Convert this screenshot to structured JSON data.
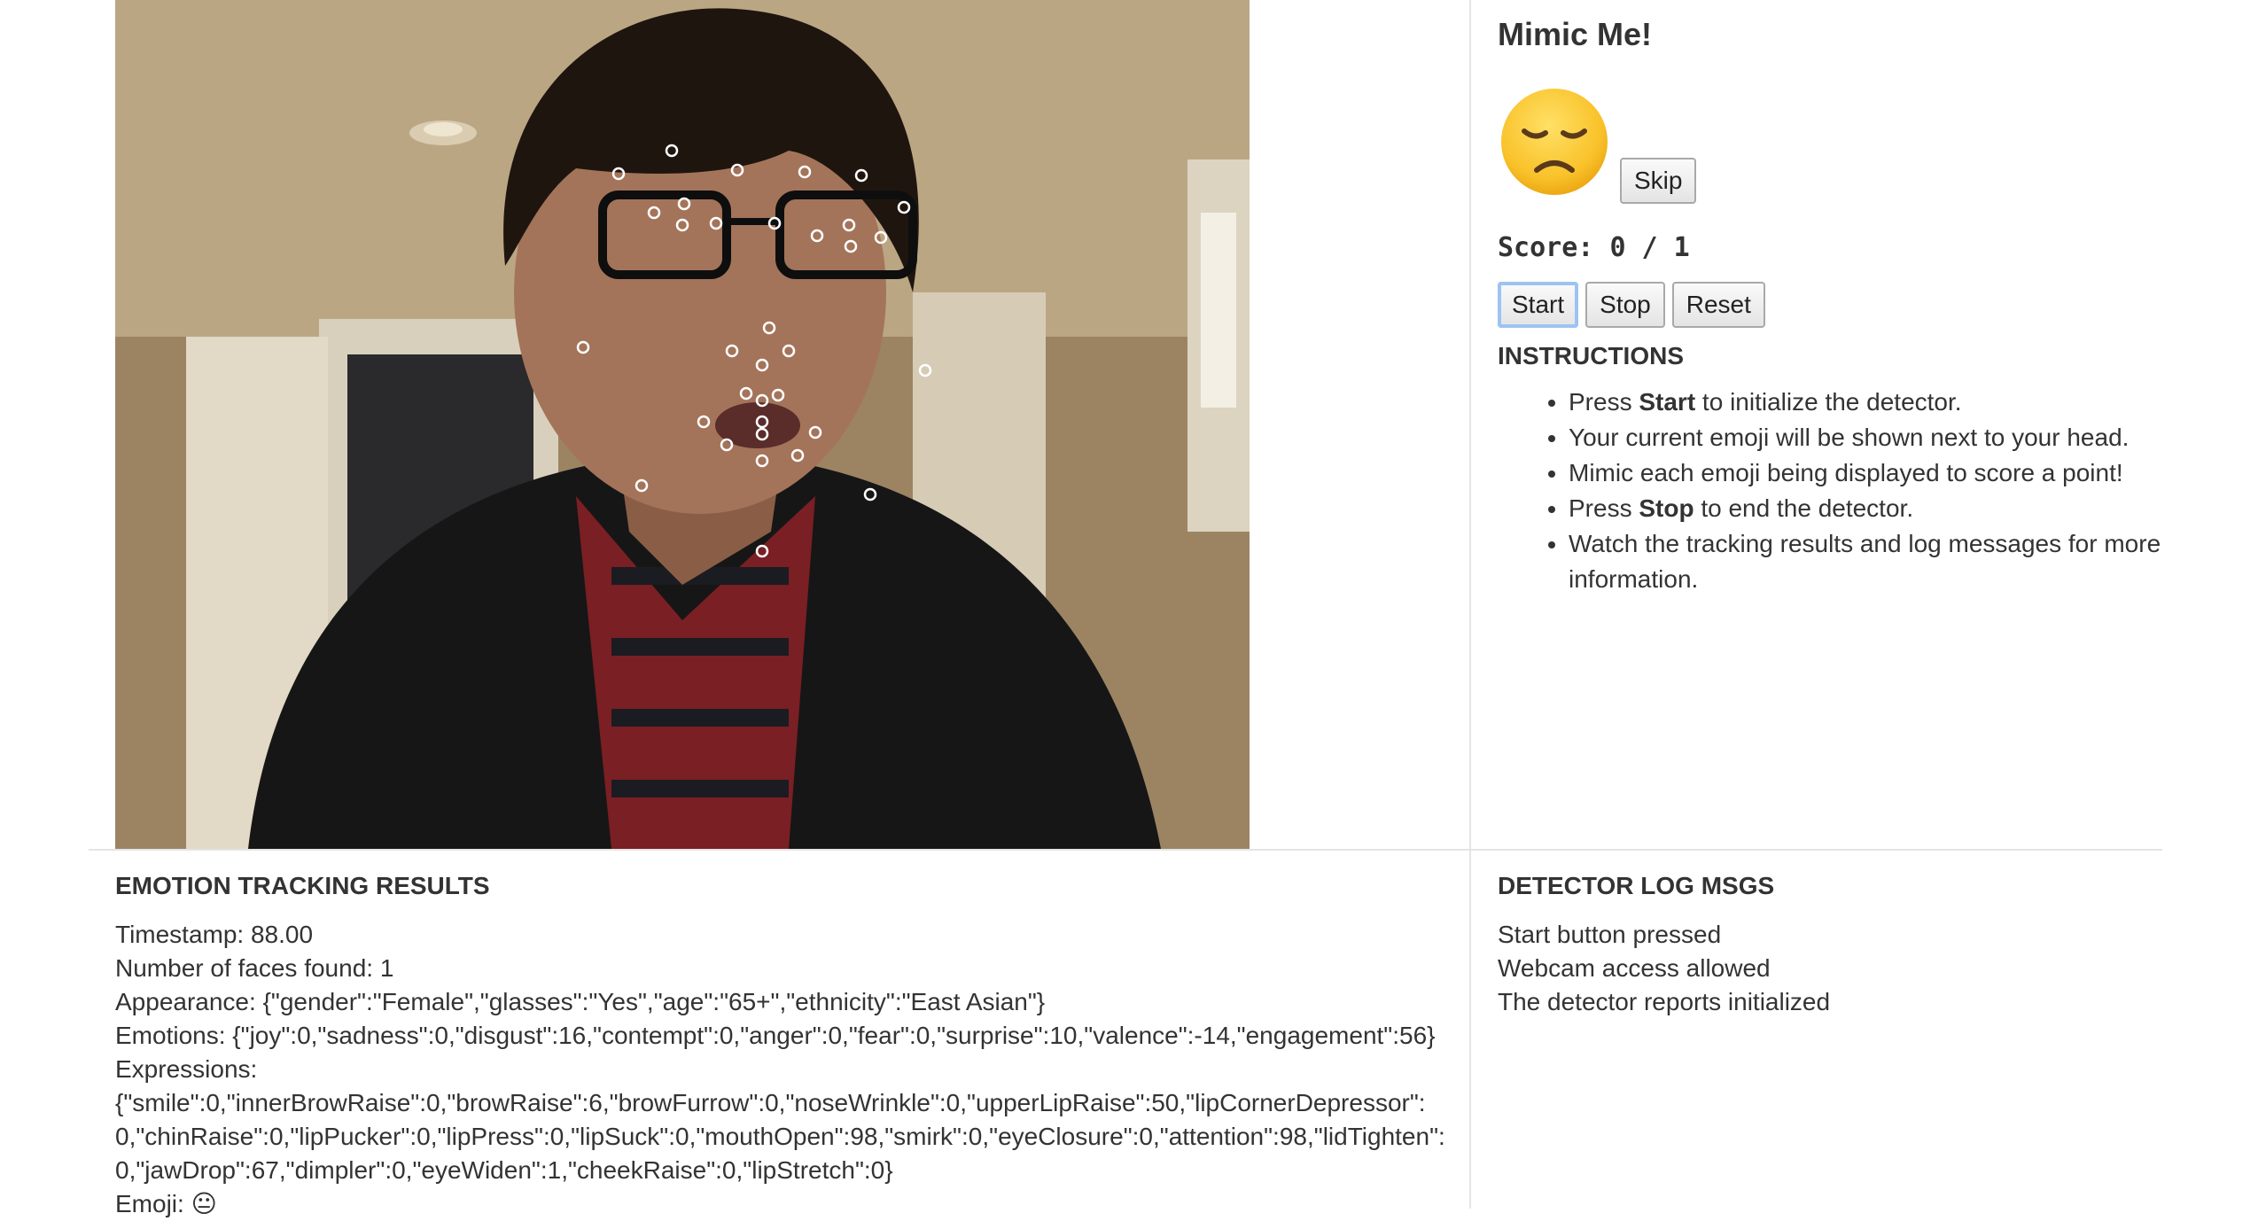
{
  "app": {
    "title": "Mimic Me!"
  },
  "controls": {
    "skip": "Skip",
    "start": "Start",
    "stop": "Stop",
    "reset": "Reset"
  },
  "score": {
    "label": "Score:",
    "value": "0 / 1"
  },
  "target_emoji": {
    "icon": "disappointed-face-emoji",
    "char": "😞"
  },
  "instructions": {
    "heading": "INSTRUCTIONS",
    "items": [
      {
        "pre": "Press ",
        "bold": "Start",
        "post": " to initialize the detector."
      },
      {
        "pre": "Your current emoji will be shown next to your head.",
        "bold": "",
        "post": ""
      },
      {
        "pre": "Mimic each emoji being displayed to score a point!",
        "bold": "",
        "post": ""
      },
      {
        "pre": "Press ",
        "bold": "Stop",
        "post": " to end the detector."
      },
      {
        "pre": "Watch the tracking results and log messages for more information.",
        "bold": "",
        "post": ""
      }
    ]
  },
  "results": {
    "heading": "EMOTION TRACKING RESULTS",
    "timestamp": "Timestamp: 88.00",
    "faces": "Number of faces found: 1",
    "appearance": "Appearance: {\"gender\":\"Female\",\"glasses\":\"Yes\",\"age\":\"65+\",\"ethnicity\":\"East Asian\"}",
    "emotions": "Emotions: {\"joy\":0,\"sadness\":0,\"disgust\":16,\"contempt\":0,\"anger\":0,\"fear\":0,\"surprise\":10,\"valence\":-14,\"engagement\":56}",
    "expressions_label": "Expressions:",
    "expressions": "{\"smile\":0,\"innerBrowRaise\":0,\"browRaise\":6,\"browFurrow\":0,\"noseWrinkle\":0,\"upperLipRaise\":50,\"lipCornerDepressor\":0,\"chinRaise\":0,\"lipPucker\":0,\"lipPress\":0,\"lipSuck\":0,\"mouthOpen\":98,\"smirk\":0,\"eyeClosure\":0,\"attention\":98,\"lidTighten\":0,\"jawDrop\":67,\"dimpler\":0,\"eyeWiden\":1,\"cheekRaise\":0,\"lipStretch\":0}",
    "emoji_label": "Emoji:",
    "emoji_char": "😐"
  },
  "log": {
    "heading": "DETECTOR LOG MSGS",
    "messages": [
      "Start button pressed",
      "Webcam access allowed",
      "The detector reports initialized"
    ]
  },
  "webcam": {
    "icon": "webcam-feed-with-face-landmarks"
  }
}
